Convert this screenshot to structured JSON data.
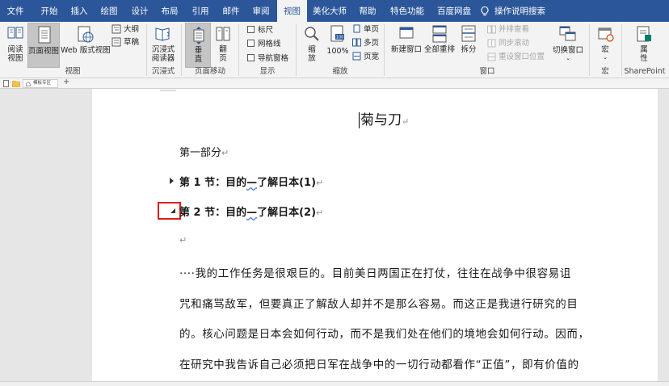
{
  "tabs": [
    {
      "label": "文件"
    },
    {
      "label": "开始"
    },
    {
      "label": "插入"
    },
    {
      "label": "绘图"
    },
    {
      "label": "设计"
    },
    {
      "label": "布局"
    },
    {
      "label": "引用"
    },
    {
      "label": "邮件"
    },
    {
      "label": "审阅"
    },
    {
      "label": "视图"
    },
    {
      "label": "美化大师"
    },
    {
      "label": "帮助"
    },
    {
      "label": "特色功能"
    },
    {
      "label": "百度网盘"
    },
    {
      "label": "操作说明搜索"
    }
  ],
  "ribbon": {
    "views": {
      "reading_view": "阅读\n视图",
      "print_layout": "页面视图",
      "web_layout": "Web 版式视图",
      "outline": "大纲",
      "draft": "草稿",
      "group_label": "视图"
    },
    "immersive": {
      "immersive_reader": "沉浸式\n阅读器",
      "group_label": "沉浸式"
    },
    "page_movement": {
      "vertical": "垂\n直",
      "side_to_side": "翻\n页",
      "group_label": "页面移动"
    },
    "show": {
      "ruler": "标尺",
      "gridlines": "网格线",
      "navigation_pane": "导航窗格",
      "group_label": "显示"
    },
    "zoom": {
      "zoom": "缩\n放",
      "hundred": "100%",
      "one_page": "单页",
      "multiple_pages": "多页",
      "page_width": "页宽",
      "group_label": "缩放"
    },
    "window": {
      "new_window": "新建窗口",
      "arrange_all": "全部重排",
      "split": "拆分",
      "view_side_by_side": "并排查看",
      "synchronous_scrolling": "同步滚动",
      "reset_window_position": "重设窗口位置",
      "switch_windows": "切换窗口",
      "group_label": "窗口"
    },
    "macros": {
      "macros": "宏",
      "group_label": "宏"
    },
    "sharepoint": {
      "properties": "属\n性",
      "group_label": "SharePoint"
    }
  },
  "mini_tab": {
    "label": "模板专区"
  },
  "document": {
    "title": "菊与刀",
    "part": "第一部分",
    "section1": {
      "prefix": "第 1 节：目的",
      "dash": "—",
      "suffix": "了解日本(1)"
    },
    "section2": {
      "prefix": "第 2 节：目的",
      "dash": "—",
      "suffix": "了解日本(2)"
    },
    "paragraph_lines": [
      "····我的工作任务是很艰巨的。目前美日两国正在打仗，往往在战争中很容易诅",
      "咒和痛骂敌军，但要真正了解敌人却并不是那么容易。而这正是我进行研究的目",
      "的。核心问题是日本会如何行动，而不是我们处在他们的境地会如何行动。因而，",
      "在研究中我告诉自己必须把日军在战争中的一切行动都看作“正值”，即有价值的"
    ],
    "para_mark": "↵"
  },
  "colors": {
    "ribbon_blue": "#2b579a",
    "highlight_red": "#e01a1a"
  }
}
